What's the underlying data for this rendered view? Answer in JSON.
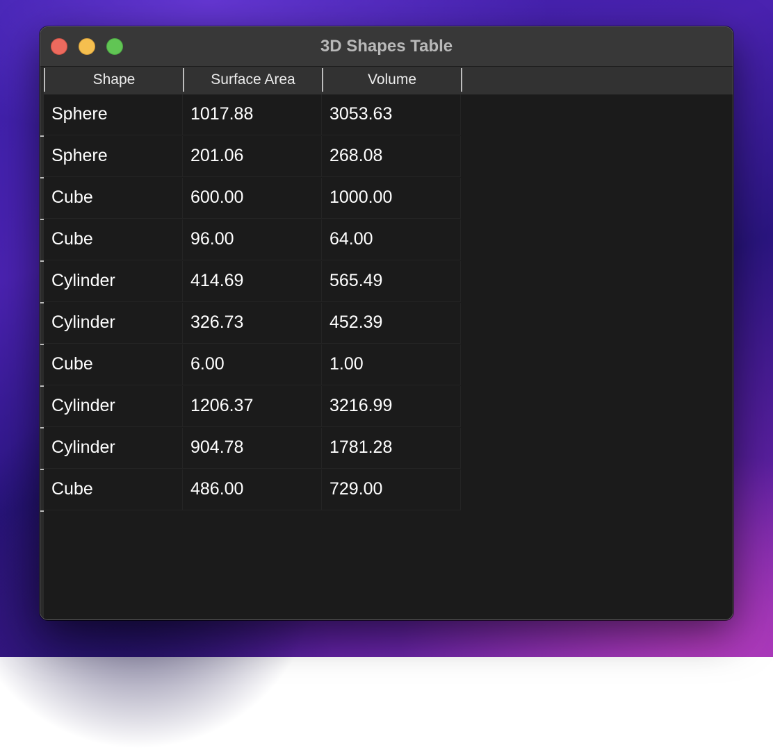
{
  "window": {
    "title": "3D Shapes Table"
  },
  "table": {
    "columns": [
      "Shape",
      "Surface Area",
      "Volume"
    ],
    "rows": [
      [
        "Sphere",
        "1017.88",
        "3053.63"
      ],
      [
        "Sphere",
        "201.06",
        "268.08"
      ],
      [
        "Cube",
        "600.00",
        "1000.00"
      ],
      [
        "Cube",
        "96.00",
        "64.00"
      ],
      [
        "Cylinder",
        "414.69",
        "565.49"
      ],
      [
        "Cylinder",
        "326.73",
        "452.39"
      ],
      [
        "Cube",
        "6.00",
        "1.00"
      ],
      [
        "Cylinder",
        "1206.37",
        "3216.99"
      ],
      [
        "Cylinder",
        "904.78",
        "1781.28"
      ],
      [
        "Cube",
        "486.00",
        "729.00"
      ]
    ]
  },
  "colors": {
    "close_button": "#ed6a5e",
    "minimize_button": "#f5bf4f",
    "zoom_button": "#61c554",
    "table_background": "#1b1b1b",
    "header_background": "#323232",
    "text": "#ffffff"
  }
}
